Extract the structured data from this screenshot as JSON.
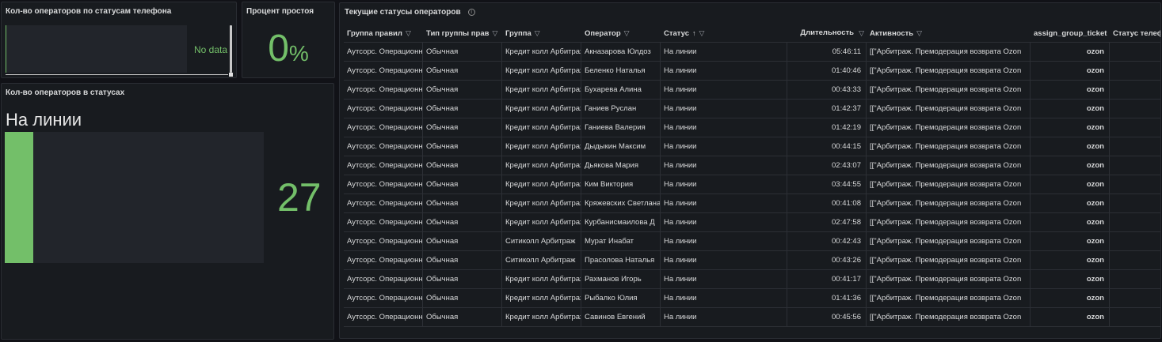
{
  "panels": {
    "phone_status": {
      "title": "Кол-во операторов по статусам телефона",
      "no_data": "No data"
    },
    "idle": {
      "title": "Процент простоя",
      "value": "0",
      "unit": "%"
    },
    "status_count": {
      "title": "Кол-во операторов в статусах",
      "status": "На линии",
      "value": "27",
      "fill_fraction": 0.11
    },
    "current": {
      "title": "Текущие статусы операторов"
    }
  },
  "icons": {
    "info": "info-circle-icon",
    "filter": "filter-icon",
    "sort": "sort-ascending-icon"
  },
  "colors": {
    "accent_green": "#73bf69",
    "background": "#111217",
    "panel": "#181b1f"
  },
  "table": {
    "columns": [
      "Группа правил",
      "Тип группы прав",
      "Группа",
      "Оператор",
      "Статус",
      "Длительность",
      "Активность",
      "assign_group_ticket",
      "Статус телефона"
    ],
    "rows": [
      [
        "Аутсорс. Операционная",
        "Обычная",
        "Кредит колл Арбитраж",
        "Акназарова Юлдоз",
        "На линии",
        "05:46:11",
        "[[\"Арбитраж. Премодерация возврата Ozon",
        "ozon"
      ],
      [
        "Аутсорс. Операционная",
        "Обычная",
        "Кредит колл Арбитраж",
        "Беленко Наталья",
        "На линии",
        "01:40:46",
        "[[\"Арбитраж. Премодерация возврата Ozon",
        "ozon"
      ],
      [
        "Аутсорс. Операционная",
        "Обычная",
        "Кредит колл Арбитраж",
        "Бухарева Алина",
        "На линии",
        "00:43:33",
        "[[\"Арбитраж. Премодерация возврата Ozon",
        "ozon"
      ],
      [
        "Аутсорс. Операционная",
        "Обычная",
        "Кредит колл Арбитраж",
        "Ганиев Руслан",
        "На линии",
        "01:42:37",
        "[[\"Арбитраж. Премодерация возврата Ozon",
        "ozon"
      ],
      [
        "Аутсорс. Операционная",
        "Обычная",
        "Кредит колл Арбитраж",
        "Ганиева Валерия",
        "На линии",
        "01:42:19",
        "[[\"Арбитраж. Премодерация возврата Ozon",
        "ozon"
      ],
      [
        "Аутсорс. Операционная",
        "Обычная",
        "Кредит колл Арбитраж",
        "Дыдыкин Максим",
        "На линии",
        "00:44:15",
        "[[\"Арбитраж. Премодерация возврата Ozon",
        "ozon"
      ],
      [
        "Аутсорс. Операционная",
        "Обычная",
        "Кредит колл Арбитраж",
        "Дьякова Мария",
        "На линии",
        "02:43:07",
        "[[\"Арбитраж. Премодерация возврата Ozon",
        "ozon"
      ],
      [
        "Аутсорс. Операционная",
        "Обычная",
        "Кредит колл Арбитраж",
        "Ким Виктория",
        "На линии",
        "03:44:55",
        "[[\"Арбитраж. Премодерация возврата Ozon",
        "ozon"
      ],
      [
        "Аутсорс. Операционная",
        "Обычная",
        "Кредит колл Арбитраж",
        "Кряжевских Светлана",
        "На линии",
        "00:41:08",
        "[[\"Арбитраж. Премодерация возврата Ozon",
        "ozon"
      ],
      [
        "Аутсорс. Операционная",
        "Обычная",
        "Кредит колл Арбитраж",
        "Курбанисмаилова Д",
        "На линии",
        "02:47:58",
        "[[\"Арбитраж. Премодерация возврата Ozon",
        "ozon"
      ],
      [
        "Аутсорс. Операционная",
        "Обычная",
        "Ситиколл Арбитраж",
        "Мурат Инабат",
        "На линии",
        "00:42:43",
        "[[\"Арбитраж. Премодерация возврата Ozon",
        "ozon"
      ],
      [
        "Аутсорс. Операционная",
        "Обычная",
        "Ситиколл Арбитраж",
        "Прасолова Наталья",
        "На линии",
        "00:43:26",
        "[[\"Арбитраж. Премодерация возврата Ozon",
        "ozon"
      ],
      [
        "Аутсорс. Операционная",
        "Обычная",
        "Кредит колл Арбитраж",
        "Рахманов Игорь",
        "На линии",
        "00:41:17",
        "[[\"Арбитраж. Премодерация возврата Ozon",
        "ozon"
      ],
      [
        "Аутсорс. Операционная",
        "Обычная",
        "Кредит колл Арбитраж",
        "Рыбалко Юлия",
        "На линии",
        "01:41:36",
        "[[\"Арбитраж. Премодерация возврата Ozon",
        "ozon"
      ],
      [
        "Аутсорс. Операционная",
        "Обычная",
        "Кредит колл Арбитраж",
        "Савинов Евгений",
        "На линии",
        "00:45:56",
        "[[\"Арбитраж. Премодерация возврата Ozon",
        "ozon"
      ]
    ]
  }
}
